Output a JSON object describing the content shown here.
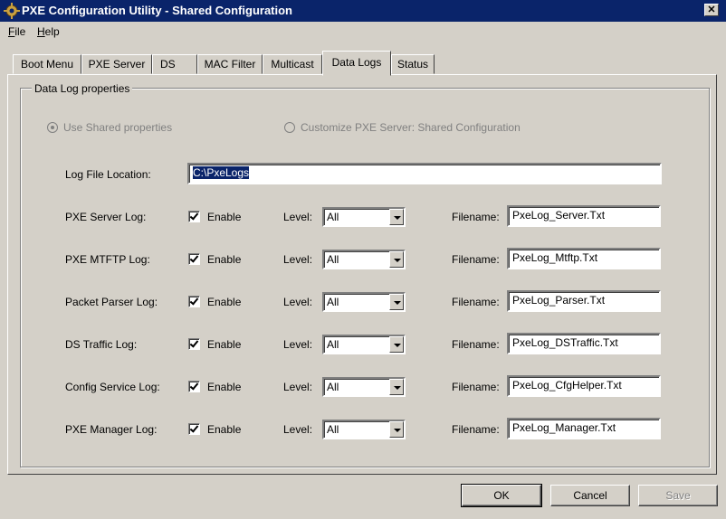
{
  "window": {
    "title": "PXE Configuration Utility - Shared Configuration",
    "close_glyph": "✕"
  },
  "menu": [
    {
      "label": "File"
    },
    {
      "label": "Help"
    }
  ],
  "tabs": [
    {
      "label": "Boot Menu",
      "active": false
    },
    {
      "label": "PXE Server",
      "active": false
    },
    {
      "label": "DS",
      "active": false
    },
    {
      "label": "MAC Filter",
      "active": false
    },
    {
      "label": "Multicast",
      "active": false
    },
    {
      "label": "Data Logs",
      "active": true
    },
    {
      "label": "Status",
      "active": false
    }
  ],
  "group": {
    "legend": "Data Log properties",
    "radio_shared": "Use Shared properties",
    "radio_custom": "Customize PXE Server:  Shared Configuration",
    "log_location_label": "Log File Location:",
    "log_location_value": "C:\\PxeLogs",
    "enable_label": "Enable",
    "level_label": "Level:",
    "filename_label": "Filename:"
  },
  "logs": [
    {
      "name": "PXE Server Log:",
      "enabled": true,
      "level": "All",
      "filename": "PxeLog_Server.Txt"
    },
    {
      "name": "PXE MTFTP Log:",
      "enabled": true,
      "level": "All",
      "filename": "PxeLog_Mtftp.Txt"
    },
    {
      "name": "Packet Parser Log:",
      "enabled": true,
      "level": "All",
      "filename": "PxeLog_Parser.Txt"
    },
    {
      "name": "DS Traffic Log:",
      "enabled": true,
      "level": "All",
      "filename": "PxeLog_DSTraffic.Txt"
    },
    {
      "name": "Config Service Log:",
      "enabled": true,
      "level": "All",
      "filename": "PxeLog_CfgHelper.Txt"
    },
    {
      "name": "PXE Manager Log:",
      "enabled": true,
      "level": "All",
      "filename": "PxeLog_Manager.Txt"
    }
  ],
  "buttons": {
    "ok": "OK",
    "cancel": "Cancel",
    "save": "Save"
  },
  "colors": {
    "titlebar": "#0a246a",
    "window_face": "#d4d0c8",
    "disabled_text": "#808080"
  }
}
